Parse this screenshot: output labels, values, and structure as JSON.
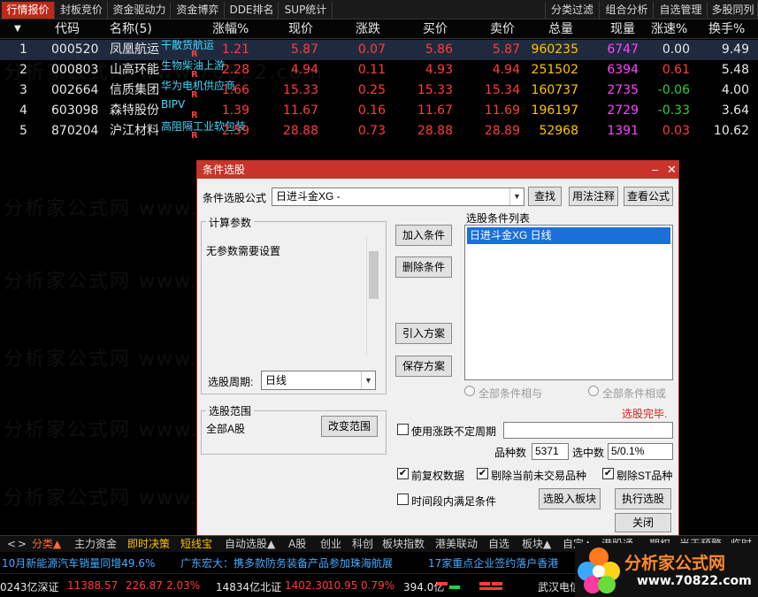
{
  "top_tabs": [
    "行情报价",
    "封板竞价",
    "资金驱动力",
    "资金博弈",
    "DDE排名",
    "SUP统计",
    "分类过滤",
    "组合分析",
    "自选管理",
    "多股同列"
  ],
  "table": {
    "headers": [
      "代码",
      "名称(5)",
      "涨幅%",
      "现价",
      "涨跌",
      "买价",
      "卖价",
      "总量",
      "现量",
      "涨速%",
      "换手%"
    ],
    "rows": [
      {
        "idx": "1",
        "code": "000520",
        "name": "凤凰航运",
        "concept": "干散货航运",
        "rflag": "R",
        "pct": "1.21",
        "price": "5.87",
        "chg": "0.07",
        "bid": "5.86",
        "ask": "5.87",
        "vol": "960235",
        "cur": "6747",
        "speed": "0.00",
        "turn": "9.49"
      },
      {
        "idx": "2",
        "code": "000803",
        "name": "山高环能",
        "concept": "生物柴油上游",
        "rflag": "R",
        "pct": "2.28",
        "price": "4.94",
        "chg": "0.11",
        "bid": "4.93",
        "ask": "4.94",
        "vol": "251502",
        "cur": "6394",
        "speed": "0.61",
        "turn": "5.48"
      },
      {
        "idx": "3",
        "code": "002664",
        "name": "信质集团",
        "concept": "华为电机供应商",
        "rflag": "R",
        "pct": "1.66",
        "price": "15.33",
        "chg": "0.25",
        "bid": "15.33",
        "ask": "15.34",
        "vol": "160737",
        "cur": "2735",
        "speed": "-0.06",
        "turn": "4.00"
      },
      {
        "idx": "4",
        "code": "603098",
        "name": "森特股份",
        "concept": "BIPV",
        "rflag": "R",
        "pct": "1.39",
        "price": "11.67",
        "chg": "0.16",
        "bid": "11.67",
        "ask": "11.69",
        "vol": "196197",
        "cur": "2729",
        "speed": "-0.33",
        "turn": "3.64"
      },
      {
        "idx": "5",
        "code": "870204",
        "name": "沪江材料",
        "concept": "高阻隔工业软包装",
        "rflag": "R",
        "pct": "2.59",
        "price": "28.88",
        "chg": "0.73",
        "bid": "28.88",
        "ask": "28.89",
        "vol": "52968",
        "cur": "1391",
        "speed": "0.03",
        "turn": "10.62"
      }
    ]
  },
  "watermark": "分析家公式网 www.70822.com",
  "dialog": {
    "title": "条件选股",
    "formula_label": "条件选股公式",
    "formula_value": "日进斗金XG  -",
    "btn_find": "查找",
    "btn_usage": "用法注释",
    "btn_view": "查看公式",
    "params_title": "计算参数",
    "params_text": "无参数需要设置",
    "period_label": "选股周期:",
    "period_value": "日线",
    "btn_add": "加入条件",
    "btn_delete": "删除条件",
    "btn_import": "引入方案",
    "btn_save": "保存方案",
    "list_title": "选股条件列表",
    "list_item": "日进斗金XG  日线",
    "radio_and": "全部条件相与",
    "radio_or": "全部条件相或",
    "status": "选股完毕.",
    "range_title": "选股范围",
    "range_value": "全部A股",
    "btn_range": "改变范围",
    "chk_uncertain": "使用涨跌不定周期",
    "count_label": "品种数",
    "count_value": "5371",
    "hit_label": "选中数",
    "hit_value": "5/0.1%",
    "chk_fq": "前复权数据",
    "chk_exclude_today": "剔除当前未交易品种",
    "chk_exclude_st": "剔除ST品种",
    "chk_period": "时间段内满足条件",
    "btn_to_block": "选股入板块",
    "btn_run": "执行选股",
    "btn_close": "关闭"
  },
  "bottom_tabs": [
    "<",
    ">",
    "分类▲",
    "主力资金",
    "即时决策",
    "短线宝",
    "自动选股▲",
    "A股",
    "创业",
    "科创",
    "板块指数",
    "港美联动",
    "自选",
    "板块▲",
    "自定▲",
    "港股通",
    "期权",
    "当天预警",
    "临时"
  ],
  "news": [
    "10月新能源汽车销量同增49.6%",
    "广东宏大：携多款防务装备产品参加珠海航展",
    "17家重点企业签约落户香港"
  ],
  "status": {
    "amount1": "0243亿深证",
    "szzs": "11388.57",
    "sz_chg": "226.87",
    "sz_pct": "2.03%",
    "amount2": "14834亿北证",
    "bz": "1402.30",
    "bz_chg": "10.95",
    "bz_pct": "0.79%",
    "amount3": "394.0亿",
    "city": "武汉电信"
  },
  "logo": {
    "main": "分析家公式网",
    "sub": "www.70822.com"
  }
}
